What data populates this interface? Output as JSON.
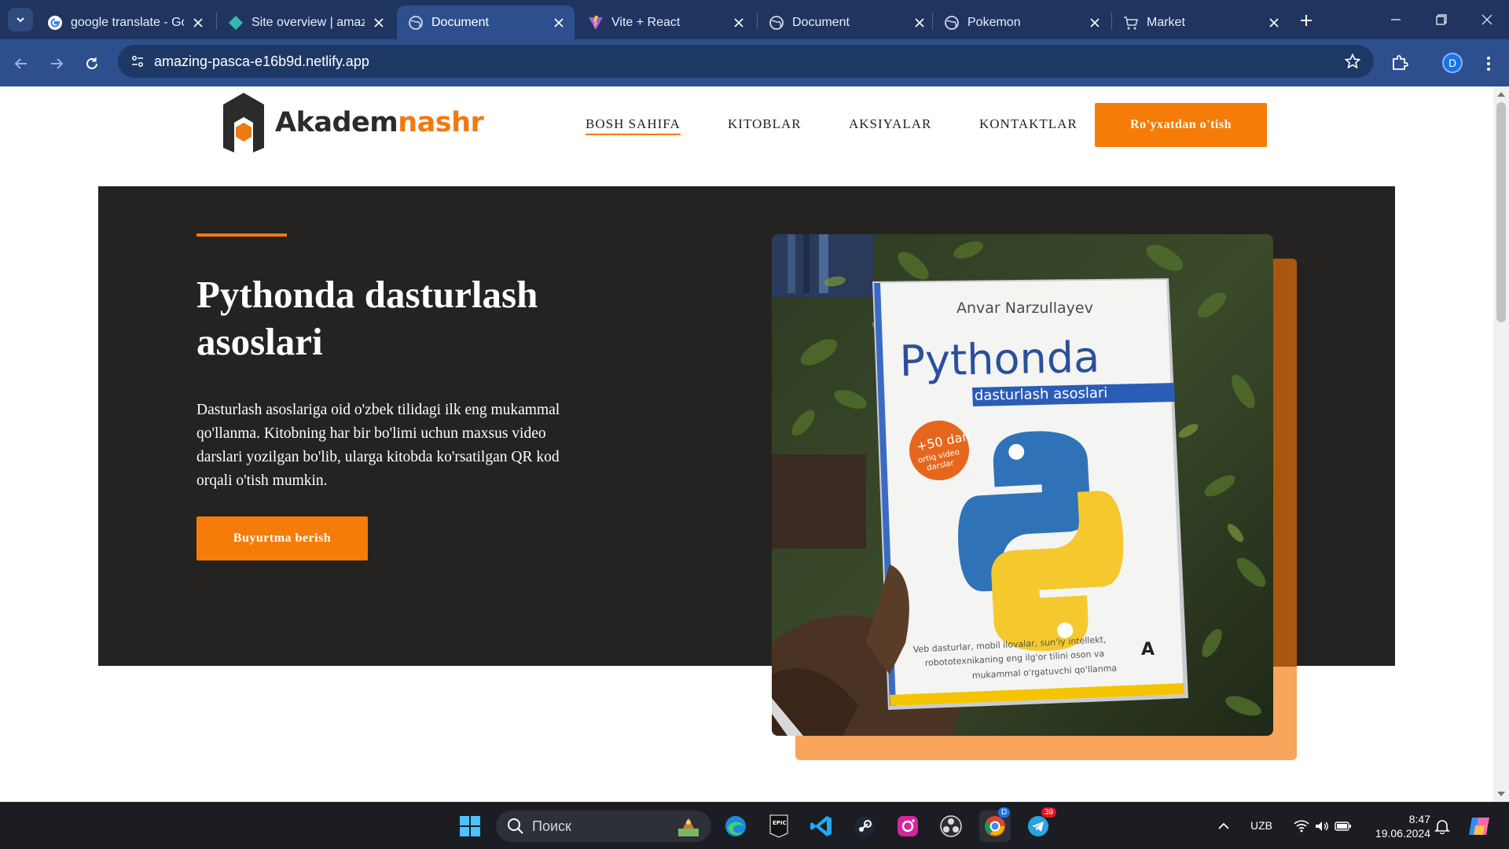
{
  "browser": {
    "tabs": [
      {
        "title": "google translate - Go",
        "icon": "google-g-icon",
        "active": false
      },
      {
        "title": "Site overview | amazi",
        "icon": "netlify-icon",
        "active": false
      },
      {
        "title": "Document",
        "icon": "globe-icon",
        "active": true
      },
      {
        "title": "Vite + React",
        "icon": "vite-icon",
        "active": false
      },
      {
        "title": "Document",
        "icon": "globe-icon",
        "active": false
      },
      {
        "title": "Pokemon",
        "icon": "globe-icon",
        "active": false
      },
      {
        "title": "Market",
        "icon": "cart-icon",
        "active": false
      }
    ],
    "url": "amazing-pasca-e16b9d.netlify.app",
    "profile_initial": "D",
    "colors": {
      "tabbar": "#1f3560",
      "toolbar": "#2e4f8e"
    }
  },
  "site": {
    "logo": {
      "part1": "Akadem",
      "part2": "nashr"
    },
    "nav": [
      {
        "label": "BOSH SAHIFA",
        "active": true
      },
      {
        "label": "KITOBLAR",
        "active": false
      },
      {
        "label": "AKSIYALAR",
        "active": false
      },
      {
        "label": "KONTAKTLAR",
        "active": false
      }
    ],
    "register_label": "Ro'yxatdan o'tish",
    "accent_color": "#f57c09"
  },
  "hero": {
    "title": "Pythonda dasturlash asoslari",
    "description": "Dasturlash asoslariga oid o'zbek tilidagi ilk eng mukammal qo'llanma. Kitobning har bir bo'limi uchun maxsus video darslari yozilgan bo'lib, ularga kitobda ko'rsatilgan QR kod orqali o'tish mumkin.",
    "order_label": "Buyurtma berish",
    "book": {
      "author": "Anvar Narzullayev",
      "title": "Pythonda",
      "subtitle": "dasturlash asoslari",
      "badge_line1": "+50 dan",
      "badge_line2": "ortiq video",
      "badge_line3": "darslar",
      "footer_line1": "Veb dasturlar, mobil ilovalar, sun'iy intellekt,",
      "footer_line2": "robototexnikaning eng ilg'or tilini oson va",
      "footer_line3": "mukammal o'rgatuvchi qo'llanma",
      "publisher_mark": "A"
    }
  },
  "taskbar": {
    "search_placeholder": "Поиск",
    "language": "UZB",
    "time": "8:47",
    "date": "19.06.2024",
    "telegram_badge": "39",
    "chrome_badge": "D"
  }
}
